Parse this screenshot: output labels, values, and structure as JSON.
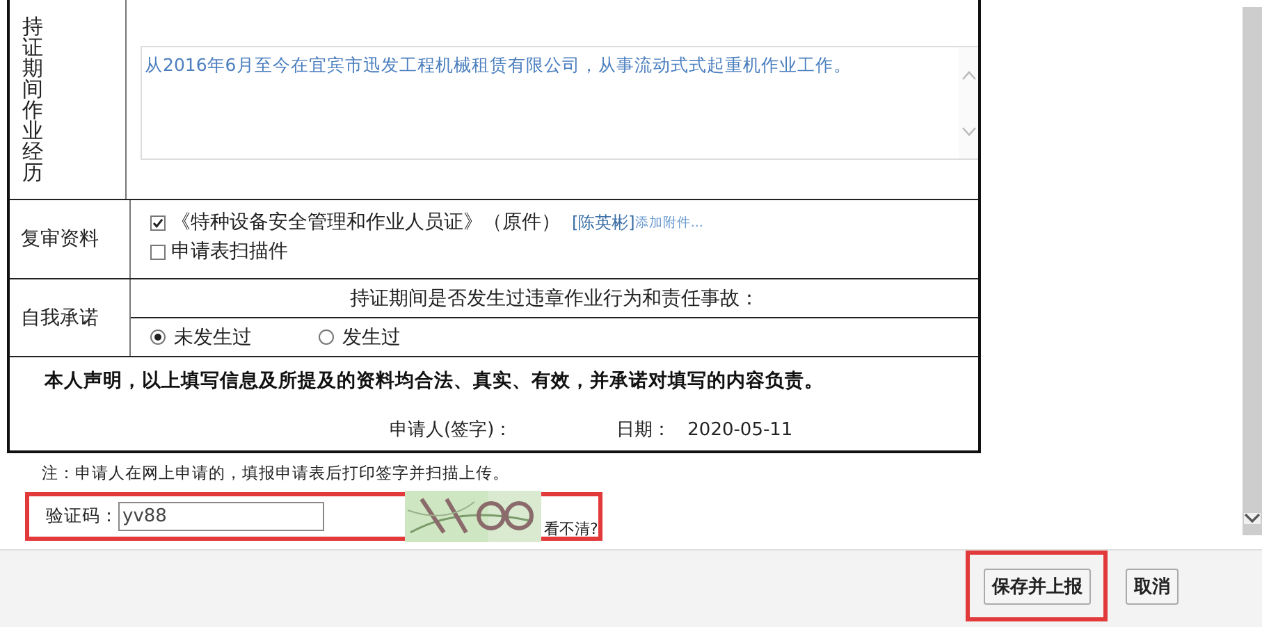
{
  "experience": {
    "label": "持证期间作业经历",
    "value": "从2016年6月至今在宜宾市迅发工程机械租赁有限公司，从事流动式式起重机作业工作。"
  },
  "review_materials": {
    "label": "复审资料",
    "items": [
      {
        "label": "《特种设备安全管理和作业人员证》（原件）",
        "checked": true,
        "uploader": "[陈英彬]",
        "attach_link": "添加附件..."
      },
      {
        "label": "申请表扫描件",
        "checked": false
      }
    ]
  },
  "self_commitment": {
    "label": "自我承诺",
    "question": "持证期间是否发生过违章作业行为和责任事故：",
    "options": [
      {
        "label": "未发生过",
        "selected": true
      },
      {
        "label": "发生过",
        "selected": false
      }
    ]
  },
  "declaration": {
    "text": "本人声明，以上填写信息及所提及的资料均合法、真实、有效，并承诺对填写的内容负责。",
    "applicant_label": "申请人(签字)：",
    "date_label": "日期：",
    "date": "2020-05-11"
  },
  "note": "注：申请人在网上申请的，填报申请表后打印签字并扫描上传。",
  "captcha": {
    "label": "验证码：",
    "value": "yv88",
    "refresh_link": "看不清?",
    "highlighted": true
  },
  "buttons": [
    {
      "label": "保存并上报",
      "highlighted": true
    },
    {
      "label": "取消",
      "highlighted": false
    }
  ]
}
